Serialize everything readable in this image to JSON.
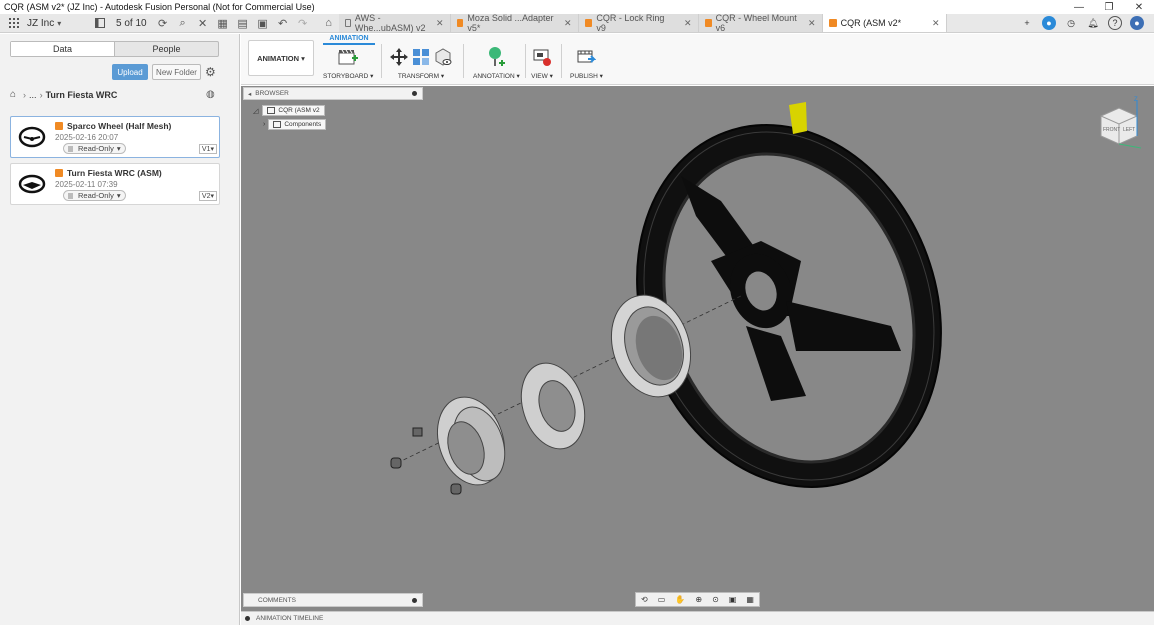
{
  "window": {
    "title": "CQR (ASM v2* (JZ Inc) - Autodesk Fusion Personal (Not for Commercial Use)",
    "controls": [
      "—",
      "❐",
      "✕"
    ]
  },
  "tabbar": {
    "team": "JZ Inc",
    "pager": "5 of 10",
    "tabs": [
      {
        "label": "AWS - Whe...ubASM) v2",
        "type": "locked"
      },
      {
        "label": "Moza Solid ...Adapter v5*",
        "type": "cube"
      },
      {
        "label": "CQR - Lock Ring v9",
        "type": "cube"
      },
      {
        "label": "CQR - Wheel Mount v6",
        "type": "cube"
      },
      {
        "label": "CQR (ASM v2*",
        "type": "cube",
        "active": true
      }
    ]
  },
  "datapanel": {
    "tab_data": "Data",
    "tab_people": "People",
    "upload": "Upload",
    "new_folder": "New Folder",
    "breadcrumb_ellipsis": "...",
    "breadcrumb_current": "Turn Fiesta WRC",
    "files": [
      {
        "name": "Sparco Wheel (Half Mesh)",
        "date": "2025-02-16 20:07",
        "access": "Read-Only",
        "version": "V1▾"
      },
      {
        "name": "Turn Fiesta WRC (ASM)",
        "date": "2025-02-11 07:39",
        "access": "Read-Only",
        "version": "V2▾"
      }
    ]
  },
  "toolbar": {
    "workspace": "ANIMATION ▾",
    "active_tab": "ANIMATION",
    "groups": {
      "storyboard": "STORYBOARD ▾",
      "transform": "TRANSFORM ▾",
      "annotation": "ANNOTATION ▾",
      "view": "VIEW ▾",
      "publish": "PUBLISH ▾"
    }
  },
  "canvas": {
    "browser_label": "BROWSER",
    "root_node": "CQR (ASM v2",
    "child_node": "Components",
    "comments_label": "COMMENTS",
    "timeline_label": "ANIMATION TIMELINE",
    "viewcube": {
      "front": "FRONT",
      "left": "LEFT",
      "axis_z": "Z"
    }
  },
  "colors": {
    "canvas_bg": "#888888",
    "accent_blue": "#2b8ad8",
    "upload_blue": "#5b9bd5",
    "cube_orange": "#f08a24",
    "wheel_marker_yellow": "#d8d300"
  }
}
